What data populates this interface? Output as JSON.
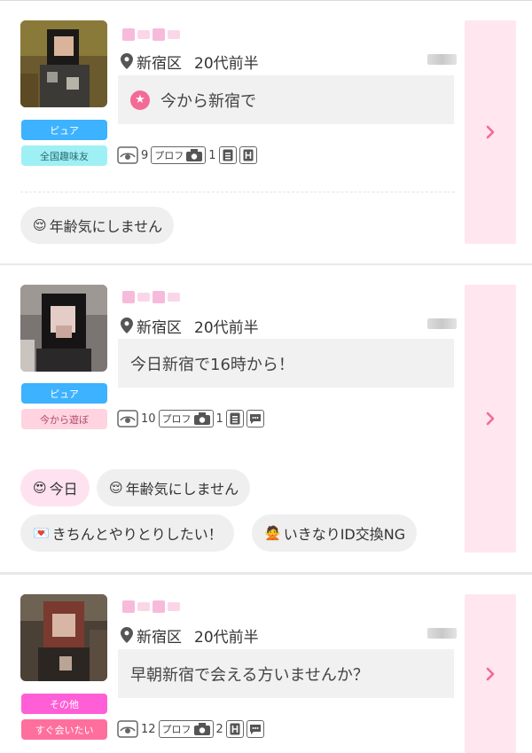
{
  "cards": [
    {
      "location": "新宿区",
      "age": "20代前半",
      "message": "今から新宿で",
      "tags": [
        "ピュア",
        "全国趣味友"
      ],
      "stats": {
        "views": "9",
        "profile_label": "プロフ",
        "photos": "1"
      },
      "chips": [
        {
          "icon": "face-icon",
          "label": "年齢気にしません"
        }
      ]
    },
    {
      "location": "新宿区",
      "age": "20代前半",
      "message": "今日新宿で16時から！",
      "tags": [
        "ピュア",
        "今から遊ぼ"
      ],
      "stats": {
        "views": "10",
        "profile_label": "プロフ",
        "photos": "1"
      },
      "chips": [
        {
          "icon": "heart-eyes-icon",
          "label": "今日"
        },
        {
          "icon": "face-icon",
          "label": "年齢気にしません"
        },
        {
          "icon": "letter-icon",
          "label": "きちんとやりとりしたい！"
        },
        {
          "icon": "person-icon",
          "label": "いきなりID交換NG"
        }
      ]
    },
    {
      "location": "新宿区",
      "age": "20代前半",
      "message": "早朝新宿で会える方いませんか？",
      "tags": [
        "その他",
        "すぐ会いたい"
      ],
      "stats": {
        "views": "12",
        "profile_label": "プロフ",
        "photos": "2"
      }
    }
  ],
  "colors": {
    "accent": "#f36a97",
    "side_panel": "#ffe6ef"
  }
}
